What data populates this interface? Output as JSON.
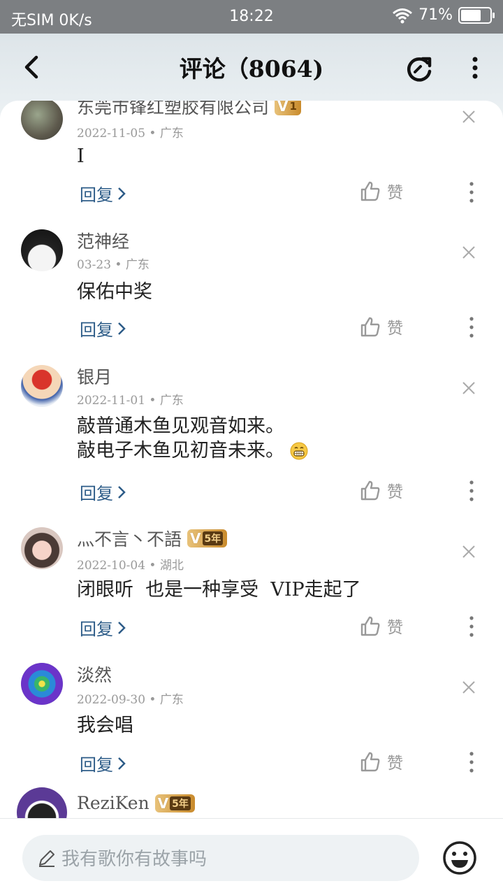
{
  "status_bar": {
    "carrier": "无SIM 0K/s",
    "time": "18:22",
    "battery": "71%",
    "battery_level": 0.71
  },
  "header": {
    "title": "评论（8064)"
  },
  "comments": [
    {
      "user": "东莞市锋红塑胶有限公司",
      "badge_level": "1",
      "date": "2022-11-05",
      "location": "广东",
      "text_lines": [
        "I"
      ],
      "reply_label": "回复",
      "like_label": "赞"
    },
    {
      "user": "范神经",
      "date": "03-23",
      "location": "广东",
      "text_lines": [
        "保佑中奖"
      ],
      "reply_label": "回复",
      "like_label": "赞"
    },
    {
      "user": "银月",
      "date": "2022-11-01",
      "location": "广东",
      "text_lines": [
        "敲普通木鱼见观音如来。",
        "敲电子木鱼见初音未来。"
      ],
      "reply_label": "回复",
      "like_label": "赞"
    },
    {
      "user": "灬不言丶不語",
      "badge_years": "5年",
      "date": "2022-10-04",
      "location": "湖北",
      "text_lines": [
        "闭眼听  也是一种享受  VIP走起了"
      ],
      "reply_label": "回复",
      "like_label": "赞"
    },
    {
      "user": "淡然",
      "date": "2022-09-30",
      "location": "广东",
      "text_lines": [
        "我会唱"
      ],
      "reply_label": "回复",
      "like_label": "赞"
    },
    {
      "user": "ReziKen",
      "badge_years": "5年"
    }
  ],
  "input": {
    "placeholder": "我有歌你有故事吗"
  },
  "icons": {
    "back": "chevron-left-icon",
    "share": "share-refresh-icon",
    "more": "more-vertical-icon",
    "thumb": "thumbs-up-icon",
    "close": "close-icon",
    "emoji": "smiley-icon",
    "pencil": "pencil-icon"
  },
  "colors": {
    "reply_link": "#2d5c88",
    "status_bar": "#7c7f82",
    "badge_gold": "#c98b2c"
  }
}
